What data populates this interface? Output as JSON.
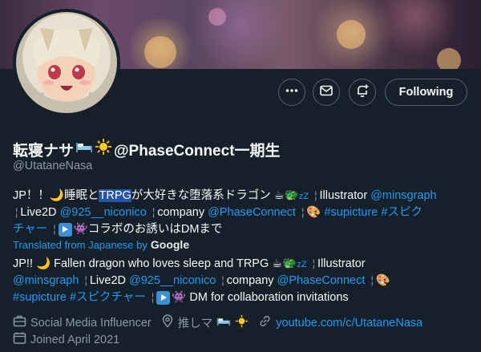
{
  "profile": {
    "display_name": "転寝ナサ",
    "display_name_suffix": "@PhaseConnect一期生",
    "handle": "@UtataneNasa"
  },
  "actions": {
    "more_label": "More",
    "message_label": "Message",
    "notify_label": "Notifications",
    "following_label": "Following"
  },
  "bio_ja": {
    "line1_pre": "JP！！",
    "line1_mid": "睡眠と",
    "line1_highlight": "TRPG",
    "line1_post": "が大好きな堕落系ドラゴン",
    "line1_illustrator": "Illustrator",
    "line1_link": "@minsgraph",
    "line2_live2d": "Live2D",
    "line2_link1": "@925__niconico",
    "line2_company": "company",
    "line2_link2": "@PhaseConnect",
    "line2_tag1": "#supicture",
    "line2_tag2": "#スピク",
    "line3_tag_cont": "チャー",
    "line3_text": "コラボのお誘いはDMまで"
  },
  "translation": {
    "label": "Translated from Japanese by",
    "provider": "Google"
  },
  "bio_en": {
    "line1_pre": "JP!!",
    "line1_text": "Fallen dragon who loves sleep and TRPG",
    "line1_illustrator": "Illustrator",
    "line2_link": "@minsgraph",
    "line2_live2d": "Live2D",
    "line2_link1": "@925__niconico",
    "line2_company": "company",
    "line2_link2": "@PhaseConnect",
    "line3_tag1": "#supicture",
    "line3_tag2": "#スピクチャー",
    "line3_text": "DM for collaboration invitations"
  },
  "meta": {
    "category": "Social Media Influencer",
    "location": "推しマ",
    "website": "youtube.com/c/UtataneNasa",
    "joined": "Joined April 2021"
  },
  "colors": {
    "background": "#15202b",
    "link": "#1d9bf0",
    "muted": "#8b98a5",
    "text": "#f7f9f9"
  }
}
